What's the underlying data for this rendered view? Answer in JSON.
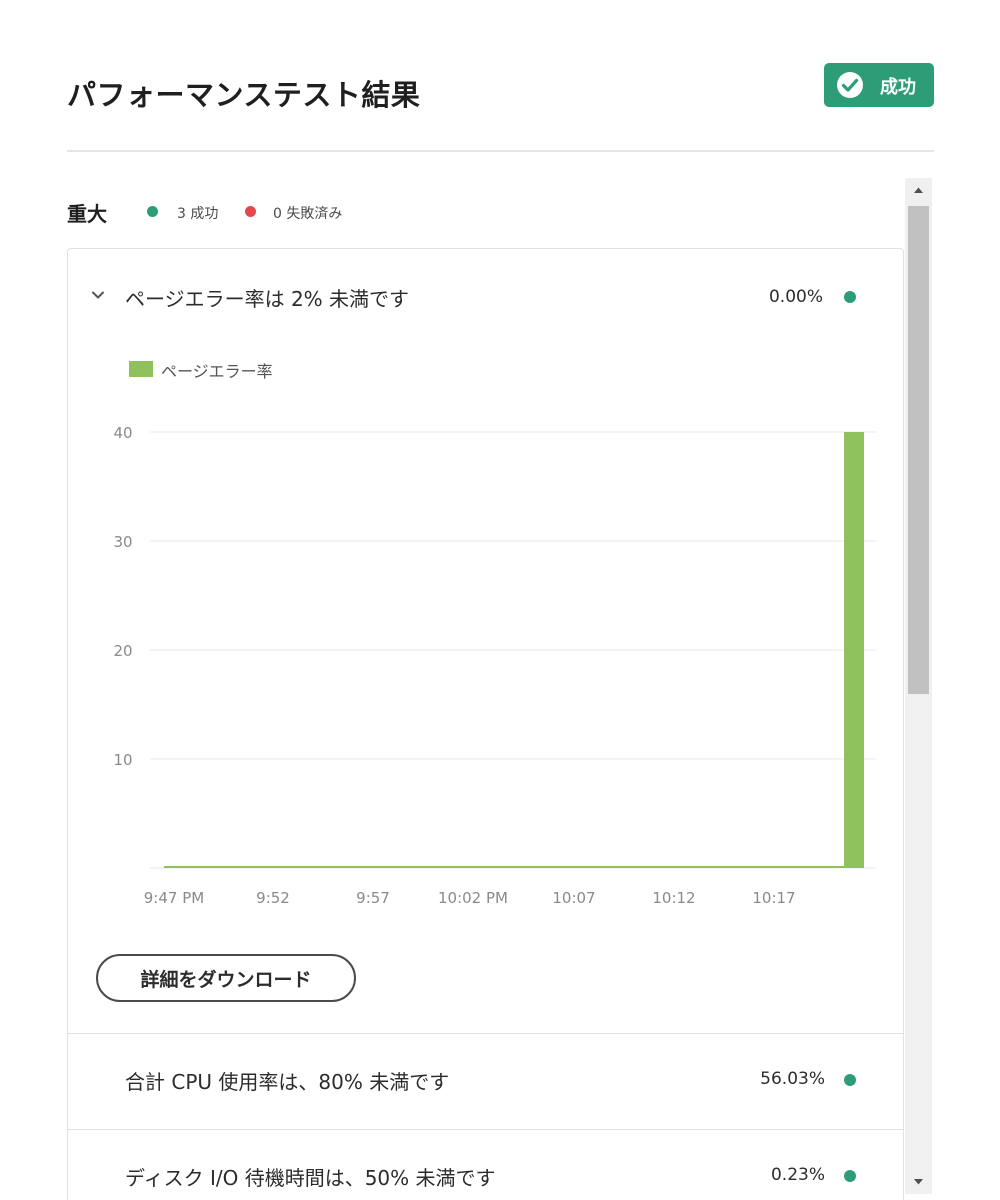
{
  "header": {
    "title": "パフォーマンステスト結果",
    "status_label": "成功",
    "status_color": "#2d9d78"
  },
  "severity": {
    "title": "重大",
    "passed_text": "3 成功",
    "failed_text": "0 失敗済み"
  },
  "expanded_test": {
    "label": "ページエラー率は 2% 未満です",
    "value": "0.00%",
    "download_label": "詳細をダウンロード"
  },
  "chart_data": {
    "type": "bar",
    "series": [
      {
        "name": "ページエラー率",
        "color": "#8fc15c",
        "x": [
          "9:47 PM",
          "9:48",
          "9:49",
          "9:50",
          "9:51",
          "9:52",
          "9:53",
          "9:54",
          "9:55",
          "9:56",
          "9:57",
          "9:58",
          "9:59",
          "10:00",
          "10:01",
          "10:02 PM",
          "10:03",
          "10:04",
          "10:05",
          "10:06",
          "10:07",
          "10:08",
          "10:09",
          "10:10",
          "10:11",
          "10:12",
          "10:13",
          "10:14",
          "10:15",
          "10:16",
          "10:17",
          "10:18",
          "10:19",
          "10:20",
          "10:21"
        ],
        "values": [
          0,
          0,
          0,
          0,
          0,
          0,
          0,
          0,
          0,
          0,
          0,
          0,
          0,
          0,
          0,
          0,
          0,
          0,
          0,
          0,
          0,
          0,
          0,
          0,
          0,
          0,
          0,
          0,
          0,
          0,
          0,
          0,
          0,
          0,
          40
        ]
      }
    ],
    "x_tick_labels": [
      "9:47 PM",
      "9:52",
      "9:57",
      "10:02 PM",
      "10:07",
      "10:12",
      "10:17"
    ],
    "y_ticks": [
      10,
      20,
      30,
      40
    ],
    "ylim": [
      0,
      40
    ],
    "grid": true,
    "legend": "top-left"
  },
  "other_tests": [
    {
      "label": "合計 CPU 使用率は、80% 未満です",
      "value": "56.03%"
    },
    {
      "label": "ディスク I/O 待機時間は、50% 未満です",
      "value": "0.23%"
    }
  ]
}
